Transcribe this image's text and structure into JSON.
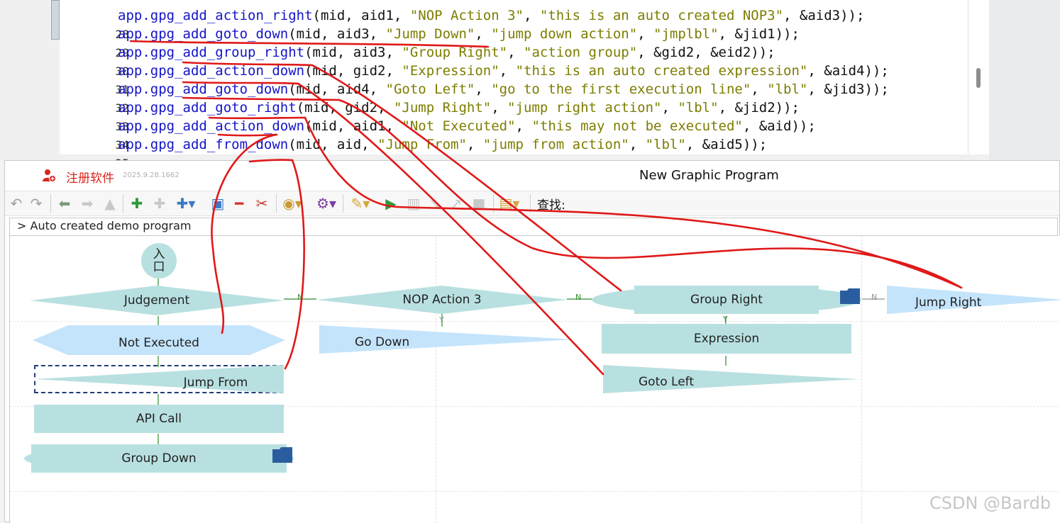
{
  "editor": {
    "lines": [
      {
        "num": "28",
        "fn": "app.gpg_add_action_right",
        "args": "(mid, aid1, ",
        "s1": "\"NOP Action 3\"",
        "m1": ", ",
        "s2": "\"this is an auto created NOP3\"",
        "tail": ", &aid3));"
      },
      {
        "num": "29",
        "fn": "app.gpg_add_goto_down",
        "args": "(mid, aid3, ",
        "s1": "\"Jump Down\"",
        "m1": ", ",
        "s2": "\"jump down action\"",
        "m2": ", ",
        "s3": "\"jmplbl\"",
        "tail": ", &jid1));"
      },
      {
        "num": "30",
        "fn": "app.gpg_add_group_right",
        "args": "(mid, aid3, ",
        "s1": "\"Group Right\"",
        "m1": ", ",
        "s2": "\"action group\"",
        "tail": ", &gid2, &eid2));"
      },
      {
        "num": "31",
        "fn": "app.gpg_add_action_down",
        "args": "(mid, gid2, ",
        "s1": "\"Expression\"",
        "m1": ", ",
        "s2": "\"this is an auto created expression\"",
        "tail": ", &aid4));"
      },
      {
        "num": "32",
        "fn": "app.gpg_add_goto_down",
        "args": "(mid, aid4, ",
        "s1": "\"Goto Left\"",
        "m1": ", ",
        "s2": "\"go to the first execution line\"",
        "m2": ", ",
        "s3": "\"lbl\"",
        "tail": ", &jid3));"
      },
      {
        "num": "33",
        "fn": "app.gpg_add_goto_right",
        "args": "(mid, gid2, ",
        "s1": "\"Jump Right\"",
        "m1": ", ",
        "s2": "\"jump right action\"",
        "m2": ", ",
        "s3": "\"lbl\"",
        "tail": ", &jid2));"
      },
      {
        "num": "34",
        "fn": "app.gpg_add_action_down",
        "args": "(mid, aid1, ",
        "s1": "\"Not Executed\"",
        "m1": ", ",
        "s2": "\"this may not be executed\"",
        "tail": ", &aid));"
      },
      {
        "num": "35",
        "fn": "app.gpg_add_from_down",
        "args": "(mid, aid, ",
        "s1": "\"Jump From\"",
        "m1": ", ",
        "s2": "\"jump from action\"",
        "m2": ", ",
        "s3": "\"lbl\"",
        "tail": ", &aid5));"
      }
    ]
  },
  "app": {
    "register_label": "注册软件",
    "version": "2025.9.28.1662",
    "title": "New Graphic Program",
    "search_label": "查找:",
    "breadcrumb": "> Auto created demo program"
  },
  "diagram": {
    "entry": "入口",
    "judgement": "Judgement",
    "not_executed": "Not Executed",
    "jump_from": "Jump From",
    "api_call": "API Call",
    "group_down": "Group Down",
    "nop_action_3": "NOP Action 3",
    "go_down": "Go Down",
    "group_right": "Group Right",
    "expression": "Expression",
    "goto_left": "Goto Left",
    "jump_right": "Jump Right",
    "n_label": "N",
    "y_label": "Y"
  },
  "watermark": "CSDN @Bardb",
  "colors": {
    "node_teal": "#b9e0e0",
    "node_blue": "#c4e4fb",
    "function": "#1414c8",
    "string": "#7d7d00",
    "annotation_red": "#e01818",
    "folder_blue": "#2a5d9f"
  }
}
